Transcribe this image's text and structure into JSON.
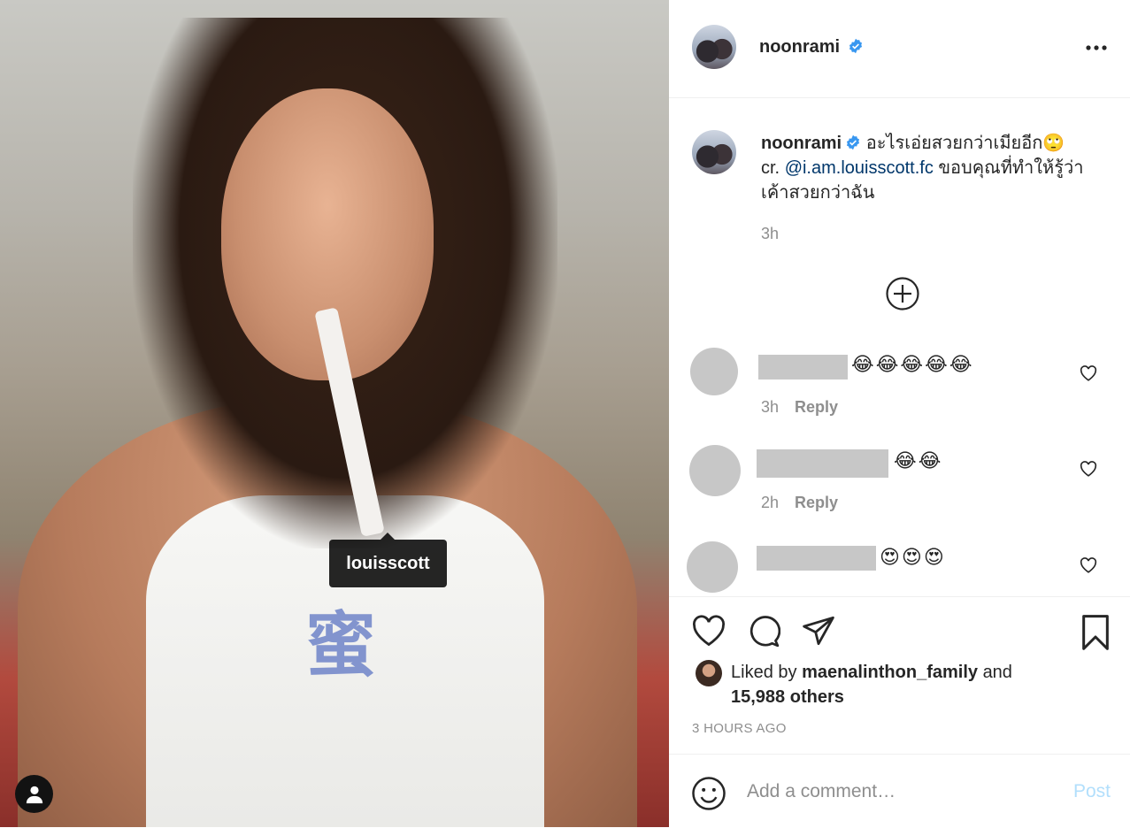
{
  "photo": {
    "tag_label": "louisscott"
  },
  "post": {
    "username": "noonrami",
    "caption_line": "อะไรเอ่ยสวยกว่าเมียอีก🙄",
    "caption_cr": "cr.",
    "caption_mention": "@i.am.louisscott.fc",
    "caption_rest": "ขอบคุณที่ทำให้รู้ว่าเค้าสวยกว่าฉัน",
    "caption_time": "3h"
  },
  "comments": [
    {
      "emojis": "😂😂😂😂😂",
      "time": "3h",
      "reply": "Reply"
    },
    {
      "emojis": "😂😂",
      "time": "2h",
      "reply": "Reply"
    },
    {
      "emojis": "😍😍😍"
    }
  ],
  "likes": {
    "prefix": "Liked by",
    "user": "maenalinthon_family",
    "and": "and",
    "others": "15,988 others"
  },
  "timestamp": "3 HOURS AGO",
  "comment_box": {
    "placeholder": "Add a comment…",
    "post_label": "Post"
  },
  "colors": {
    "verified": "#3897f0",
    "mention": "#00376b",
    "post_disabled": "#b2dffc"
  }
}
